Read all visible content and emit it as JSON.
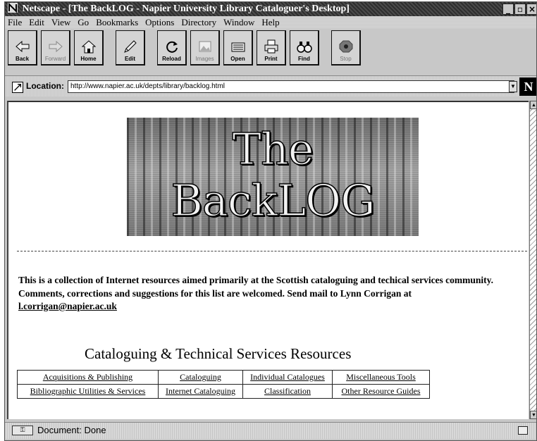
{
  "window": {
    "title": "Netscape - [The BackLOG - Napier University Library Cataloguer's Desktop]",
    "buttons": {
      "minimize": "_",
      "maximize": "▫",
      "close": "×"
    }
  },
  "menu": {
    "items": [
      "File",
      "Edit",
      "View",
      "Go",
      "Bookmarks",
      "Options",
      "Directory",
      "Window",
      "Help"
    ]
  },
  "toolbar": {
    "buttons": [
      {
        "label": "Back",
        "icon": "back-arrow-icon"
      },
      {
        "label": "Forward",
        "icon": "forward-arrow-icon"
      },
      {
        "label": "Home",
        "icon": "home-icon"
      },
      {
        "label": "Edit",
        "icon": "edit-pencil-icon"
      },
      {
        "label": "Reload",
        "icon": "reload-icon"
      },
      {
        "label": "Images",
        "icon": "images-icon"
      },
      {
        "label": "Open",
        "icon": "open-icon"
      },
      {
        "label": "Print",
        "icon": "print-icon"
      },
      {
        "label": "Find",
        "icon": "find-binoculars-icon"
      },
      {
        "label": "Stop",
        "icon": "stop-icon"
      }
    ]
  },
  "location": {
    "label": "Location:",
    "url": "http://www.napier.ac.uk/depts/library/backlog.html"
  },
  "brand": {
    "logo_letter": "N"
  },
  "page": {
    "banner_title": "The BackLOG",
    "intro_line1": "This is a collection of Internet resources aimed primarily at the Scottish cataloguing and techical services community.",
    "intro_line2": "Comments, corrections and suggestions for this list are welcomed. Send mail to Lynn Corrigan at",
    "email": "l.corrigan@napier.ac.uk",
    "section_title": "Cataloguing & Technical Services Resources",
    "table_rows": [
      [
        "Acquisitions & Publishing",
        "Cataloguing",
        "Individual Catalogues",
        "Miscellaneous Tools"
      ],
      [
        "Bibliographic Utilities & Services",
        "Internet Cataloguing",
        "Classification",
        "Other Resource Guides"
      ]
    ]
  },
  "status": {
    "text": "Document: Done"
  }
}
